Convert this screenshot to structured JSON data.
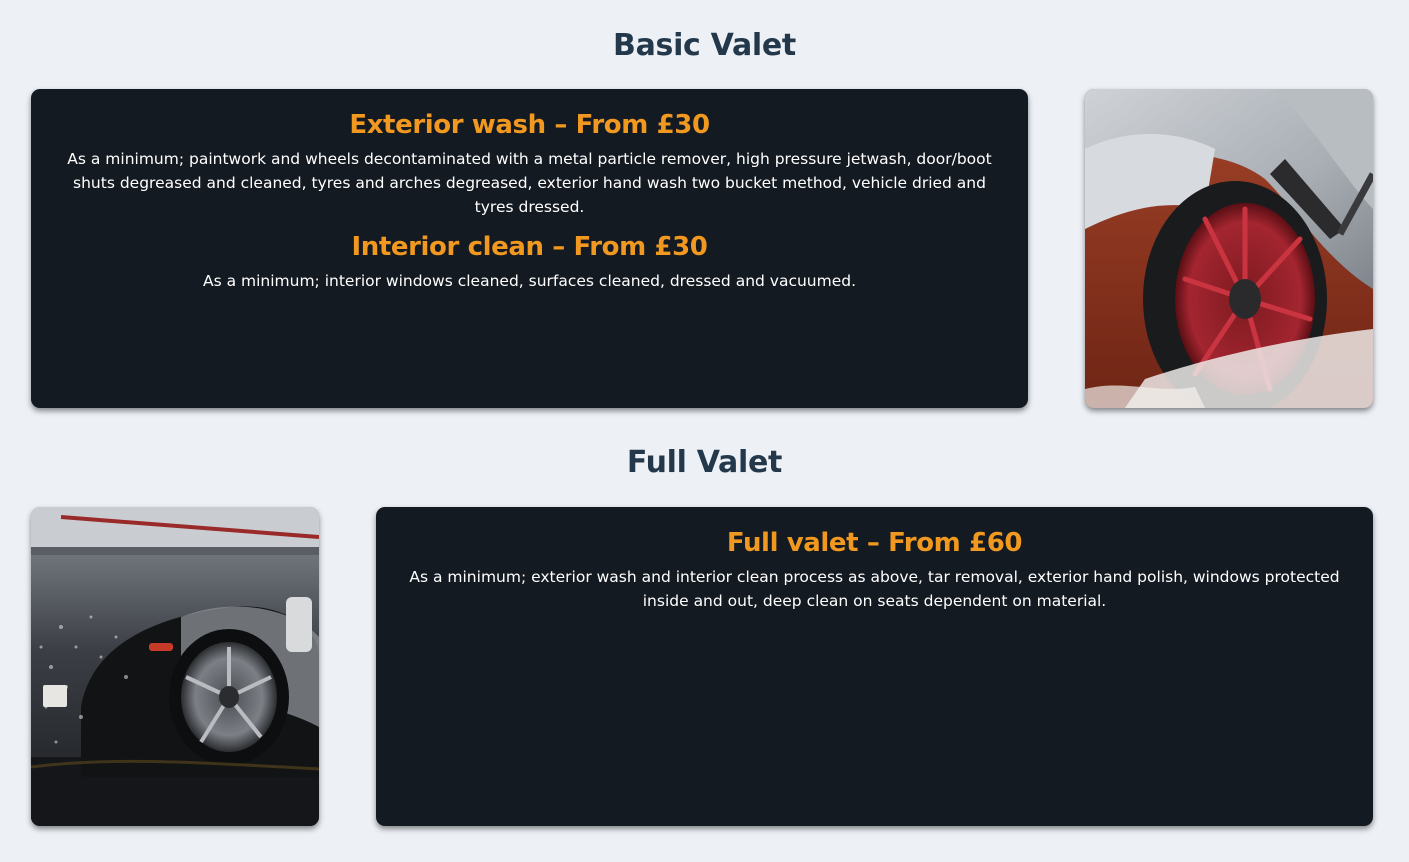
{
  "sections": {
    "basic": {
      "title": "Basic Valet",
      "services": [
        {
          "heading": "Exterior wash – From £30",
          "description": "As a minimum; paintwork and wheels decontaminated with a metal particle remover, high pressure jetwash, door/boot shuts degreased and cleaned, tyres and arches degreased, exterior hand wash two bucket method, vehicle dried and tyres dressed."
        },
        {
          "heading": "Interior clean – From £30",
          "description": "As a minimum; interior windows cleaned, surfaces cleaned, dressed and vacuumed."
        }
      ]
    },
    "full": {
      "title": "Full Valet",
      "services": [
        {
          "heading": "Full valet – From £60",
          "description": "As a minimum; exterior wash and interior clean process as above, tar removal, exterior hand polish, windows protected inside and out, deep clean on seats dependent on material."
        }
      ]
    }
  },
  "colors": {
    "background": "#edf1f6",
    "title": "#23384a",
    "card": "#141a21",
    "accent": "#f0981f",
    "text": "#ffffff"
  },
  "images": [
    {
      "name": "wheel-wash-photo",
      "description_icon": "red-wheel-brush-photo"
    },
    {
      "name": "car-foam-photo",
      "description_icon": "black-car-foam-photo"
    }
  ]
}
